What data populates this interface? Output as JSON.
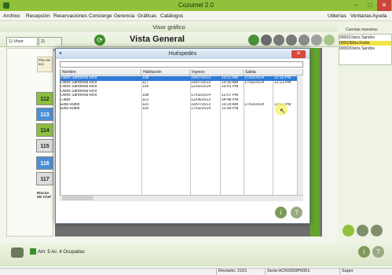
{
  "window": {
    "title": "Cozumel 2.0",
    "controls": [
      "–",
      "□",
      "✕"
    ]
  },
  "menu": {
    "left": [
      "Archivo",
      "Recepción",
      "Reservaciones",
      "Concierge",
      "Gerencia",
      "Gráficas",
      "Catálogos"
    ],
    "right": [
      "Utilerías",
      "Ventanas",
      "Ayuda"
    ]
  },
  "viewer": {
    "title": "Visor gráfico",
    "heading": "Vista General"
  },
  "tabs": [
    {
      "label": "1) Visor gráfico"
    },
    {
      "label": "2) Sábana"
    }
  ],
  "left_panel": {
    "piso_label": "Piso de acc",
    "rooms": [
      "112",
      "113",
      "114",
      "115",
      "116",
      "117"
    ],
    "room_colors": [
      "#8cbf3e",
      "#4b8fd6",
      "#8cbf3e",
      "#dcdcdc",
      "#4b8fd6",
      "#dcdcdc"
    ],
    "bottom_label": "Rincón del Chef"
  },
  "right_panel": {
    "title": "Cuentas maestras",
    "items": [
      "00001Osiris Sandov",
      "00002Elba Rubio",
      "00003Osiris Sandov"
    ]
  },
  "dialog": {
    "title": "Huéspedes",
    "columns": [
      "Nombre",
      "Habitación",
      "Ingreso",
      "Salida"
    ],
    "rows": [
      {
        "name": "Osiris Sandoval Rico",
        "room": "108",
        "in_date": "10/07/2013",
        "in_time": "10:22 AM",
        "out_date": "17/02/2014",
        "out_time": "12:16 PM"
      },
      {
        "name": "Osiris Sandoval Rico",
        "room": "117",
        "in_date": "10/07/2013",
        "in_time": "10:30 AM",
        "out_date": "17/02/2014",
        "out_time": "12:21 PM"
      },
      {
        "name": "Osiris Sandoval Rico",
        "room": "105",
        "in_date": "12/02/2014",
        "in_time": "10:41 PM",
        "out_date": "",
        "out_time": ""
      },
      {
        "name": "Osiris Sandoval Rico",
        "room": "",
        "in_date": "",
        "in_time": "",
        "out_date": "",
        "out_time": ""
      },
      {
        "name": "Osiris Sandoval Rico",
        "room": "108",
        "in_date": "17/02/2014",
        "in_time": "12:07 PM",
        "out_date": "",
        "out_time": ""
      },
      {
        "name": "Claus",
        "room": "113",
        "in_date": "12/06/2013",
        "in_time": "04:48 PM",
        "out_date": "",
        "out_time": ""
      },
      {
        "name": "Elba Rubio",
        "room": "115",
        "in_date": "10/07/2013",
        "in_time": "10:29 AM",
        "out_date": "17/02/2014",
        "out_time": "12:21 PM"
      },
      {
        "name": "Elba Rubio",
        "room": "116",
        "in_date": "17/02/2014",
        "in_time": "12:09 PM",
        "out_date": "",
        "out_time": ""
      }
    ]
  },
  "bottom": {
    "occupancy": "Am: 5 Ac: 4 Ocupadas"
  },
  "status": {
    "revision": "Revisión: 2101",
    "serie": "Serie:HCR2009P0001",
    "user": "Super"
  }
}
